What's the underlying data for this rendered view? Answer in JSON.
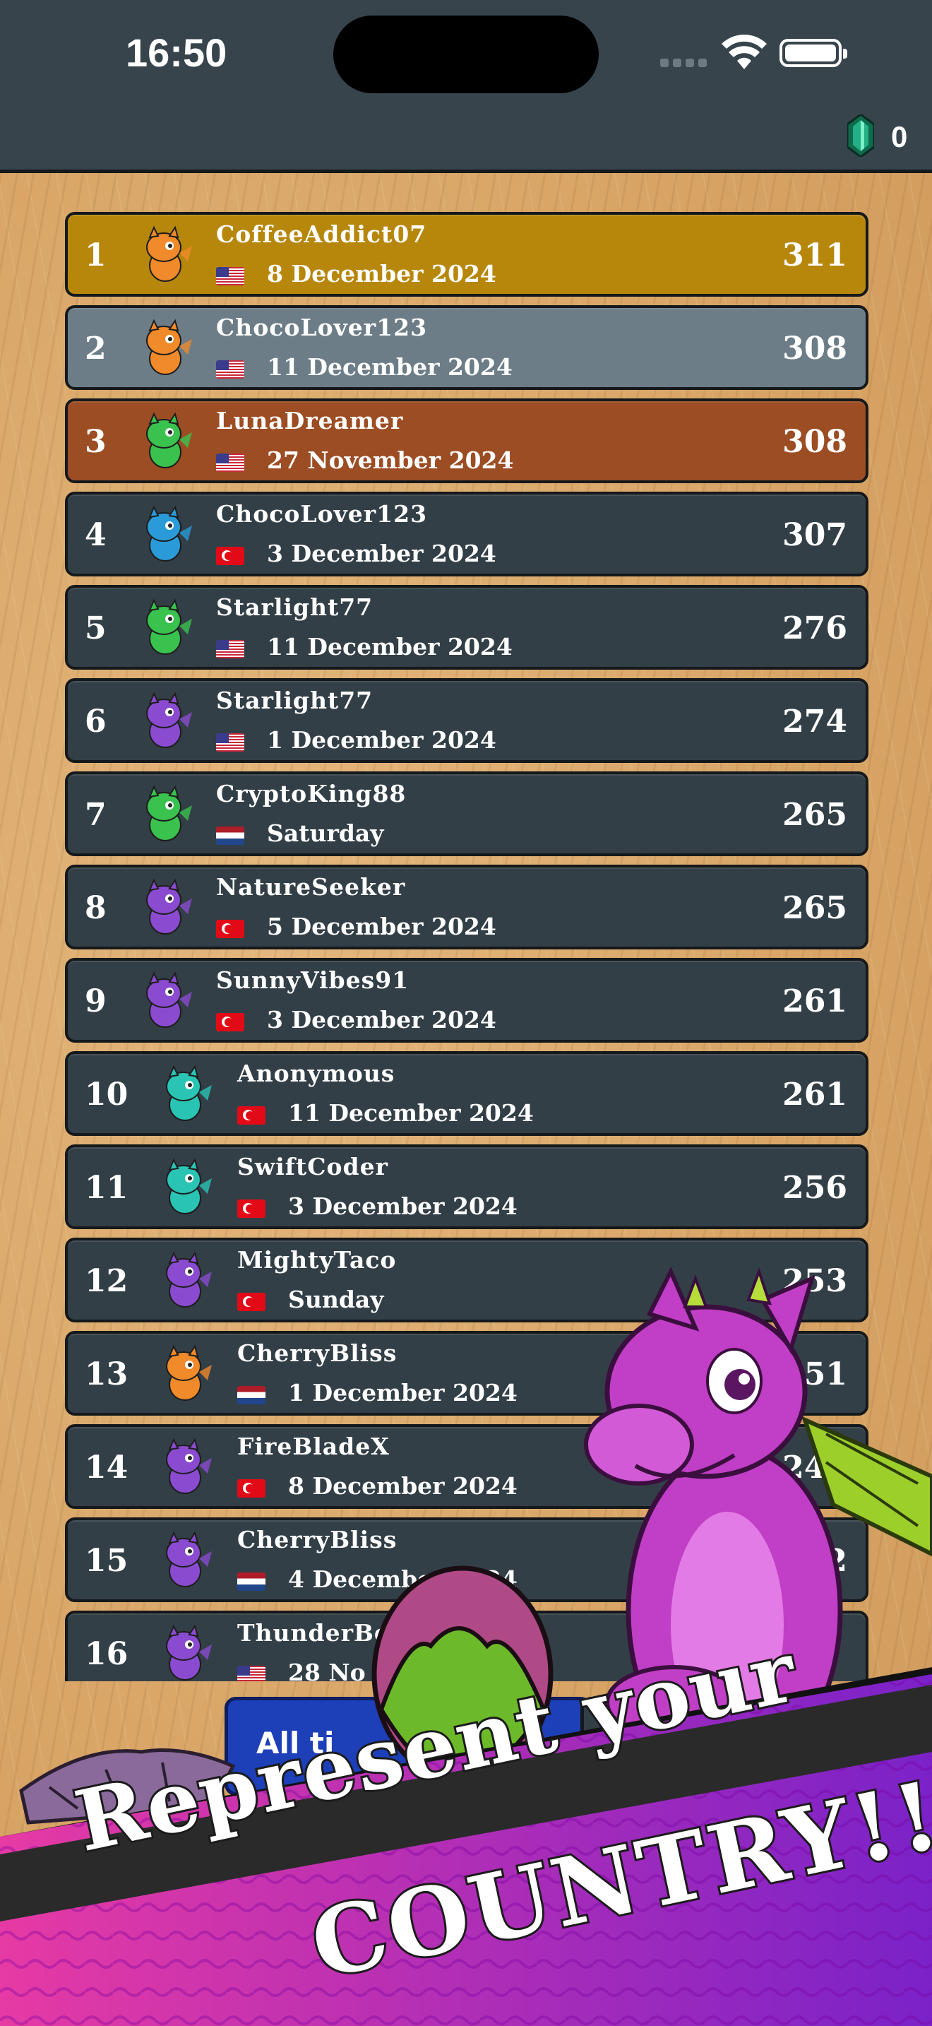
{
  "status_bar": {
    "time": "16:50"
  },
  "currency": {
    "icon": "emerald-gem-icon",
    "count": "0"
  },
  "leaderboard": [
    {
      "rank": "1",
      "name": "CoffeeAddict07",
      "country": "US",
      "date": "8 December 2024",
      "score": "311",
      "avatar": "orange-dragon-avatar",
      "tier": "gold"
    },
    {
      "rank": "2",
      "name": "ChocoLover123",
      "country": "US",
      "date": "11 December 2024",
      "score": "308",
      "avatar": "orange-dragon-avatar",
      "tier": "silver"
    },
    {
      "rank": "3",
      "name": "LunaDreamer",
      "country": "US",
      "date": "27 November 2024",
      "score": "308",
      "avatar": "green-dragon-avatar",
      "tier": "bronze"
    },
    {
      "rank": "4",
      "name": "ChocoLover123",
      "country": "TR",
      "date": "3 December 2024",
      "score": "307",
      "avatar": "blue-dragon-avatar",
      "tier": ""
    },
    {
      "rank": "5",
      "name": "Starlight77",
      "country": "US",
      "date": "11 December 2024",
      "score": "276",
      "avatar": "green-dragon-avatar",
      "tier": ""
    },
    {
      "rank": "6",
      "name": "Starlight77",
      "country": "US",
      "date": "1 December 2024",
      "score": "274",
      "avatar": "purple-dragon-avatar",
      "tier": ""
    },
    {
      "rank": "7",
      "name": "CryptoKing88",
      "country": "NL",
      "date": "Saturday",
      "score": "265",
      "avatar": "green-dragon-avatar",
      "tier": ""
    },
    {
      "rank": "8",
      "name": "NatureSeeker",
      "country": "TR",
      "date": "5 December 2024",
      "score": "265",
      "avatar": "purple-dragon-avatar",
      "tier": ""
    },
    {
      "rank": "9",
      "name": "SunnyVibes91",
      "country": "TR",
      "date": "3 December 2024",
      "score": "261",
      "avatar": "purple-dragon-avatar",
      "tier": ""
    },
    {
      "rank": "10",
      "name": "Anonymous",
      "country": "TR",
      "date": "11 December 2024",
      "score": "261",
      "avatar": "teal-dragon-avatar",
      "tier": ""
    },
    {
      "rank": "11",
      "name": "SwiftCoder",
      "country": "TR",
      "date": "3 December 2024",
      "score": "256",
      "avatar": "teal-dragon-avatar",
      "tier": ""
    },
    {
      "rank": "12",
      "name": "MightyTaco",
      "country": "TR",
      "date": "Sunday",
      "score": "253",
      "avatar": "purple-dragon-avatar",
      "tier": ""
    },
    {
      "rank": "13",
      "name": "CherryBliss",
      "country": "NL",
      "date": "1 December 2024",
      "score": "251",
      "avatar": "orange-dragon-avatar",
      "tier": ""
    },
    {
      "rank": "14",
      "name": "FireBladeX",
      "country": "TR",
      "date": "8 December 2024",
      "score": "243",
      "avatar": "purple-dragon-avatar",
      "tier": ""
    },
    {
      "rank": "15",
      "name": "CherryBliss",
      "country": "NL",
      "date": "4 December 2024",
      "score": "242",
      "avatar": "purple-dragon-avatar",
      "tier": ""
    },
    {
      "rank": "16",
      "name": "ThunderBe",
      "country": "US",
      "date": "28 No",
      "score": "",
      "avatar": "purple-dragon-avatar",
      "tier": ""
    }
  ],
  "filter_tabs": {
    "all_time_label": "All ti"
  },
  "promo_banner": {
    "line1": "Represent your",
    "line2": "COUNTRY!!"
  },
  "colors": {
    "gold": "#b7870c",
    "silver": "#6c7d87",
    "bronze": "#9c4d23",
    "row": "#333f47",
    "banner_purple": "#a42ccd"
  }
}
